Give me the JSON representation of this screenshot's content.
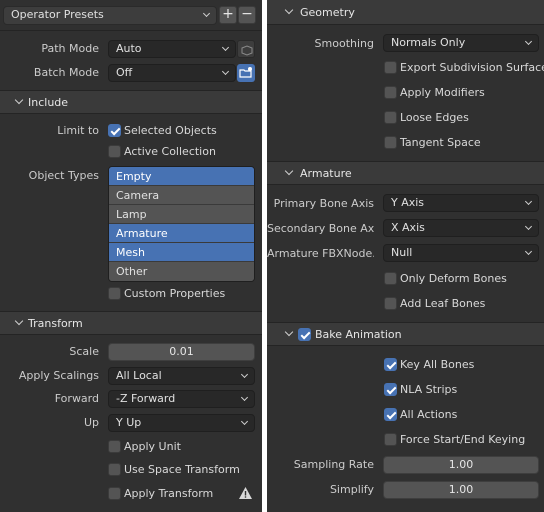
{
  "presets": {
    "label": "Operator Presets",
    "add": "+",
    "remove": "−"
  },
  "path_mode": {
    "label": "Path Mode",
    "value": "Auto"
  },
  "batch_mode": {
    "label": "Batch Mode",
    "value": "Off"
  },
  "include": {
    "title": "Include",
    "limit_to_label": "Limit to",
    "selected_objects": {
      "label": "Selected Objects",
      "checked": true
    },
    "active_collection": {
      "label": "Active Collection",
      "checked": false
    },
    "object_types_label": "Object Types",
    "object_types": [
      {
        "label": "Empty",
        "selected": true
      },
      {
        "label": "Camera",
        "selected": false
      },
      {
        "label": "Lamp",
        "selected": false
      },
      {
        "label": "Armature",
        "selected": true
      },
      {
        "label": "Mesh",
        "selected": true
      },
      {
        "label": "Other",
        "selected": false
      }
    ],
    "custom_properties": {
      "label": "Custom Properties",
      "checked": false
    }
  },
  "transform": {
    "title": "Transform",
    "scale": {
      "label": "Scale",
      "value": "0.01"
    },
    "apply_scalings": {
      "label": "Apply Scalings",
      "value": "All Local"
    },
    "forward": {
      "label": "Forward",
      "value": "-Z Forward"
    },
    "up": {
      "label": "Up",
      "value": "Y Up"
    },
    "apply_unit": {
      "label": "Apply Unit",
      "checked": false
    },
    "use_space_transform": {
      "label": "Use Space Transform",
      "checked": false
    },
    "apply_transform": {
      "label": "Apply Transform",
      "checked": false
    }
  },
  "geometry": {
    "title": "Geometry",
    "smoothing": {
      "label": "Smoothing",
      "value": "Normals Only"
    },
    "export_subdivision_surface": {
      "label": "Export Subdivision Surface",
      "checked": false
    },
    "apply_modifiers": {
      "label": "Apply Modifiers",
      "checked": false
    },
    "loose_edges": {
      "label": "Loose Edges",
      "checked": false
    },
    "tangent_space": {
      "label": "Tangent Space",
      "checked": false
    }
  },
  "armature": {
    "title": "Armature",
    "primary_bone_axis": {
      "label": "Primary Bone Axis",
      "value": "Y Axis"
    },
    "secondary_bone_axis": {
      "label": "Secondary Bone Axi",
      "value": "X Axis"
    },
    "armature_fbx_node": {
      "label": "Armature FBXNode...",
      "value": "Null"
    },
    "only_deform_bones": {
      "label": "Only Deform Bones",
      "checked": false
    },
    "add_leaf_bones": {
      "label": "Add Leaf Bones",
      "checked": false
    }
  },
  "bake_animation": {
    "title": "Bake Animation",
    "checked": true,
    "key_all_bones": {
      "label": "Key All Bones",
      "checked": true
    },
    "nla_strips": {
      "label": "NLA Strips",
      "checked": true
    },
    "all_actions": {
      "label": "All Actions",
      "checked": true
    },
    "force_start_end_keying": {
      "label": "Force Start/End Keying",
      "checked": false
    },
    "sampling_rate": {
      "label": "Sampling Rate",
      "value": "1.00"
    },
    "simplify": {
      "label": "Simplify",
      "value": "1.00"
    }
  },
  "colors": {
    "panel_bg": "#303030",
    "accent": "#4772b3",
    "header_bg": "#3a3a3a",
    "field_bg": "#282828",
    "slider_bg": "#545454"
  },
  "icons": [
    "chevron-down-icon",
    "plus-icon",
    "minus-icon",
    "path-mode-icon",
    "batch-folder-icon",
    "warning-icon",
    "checkbox-icon"
  ]
}
